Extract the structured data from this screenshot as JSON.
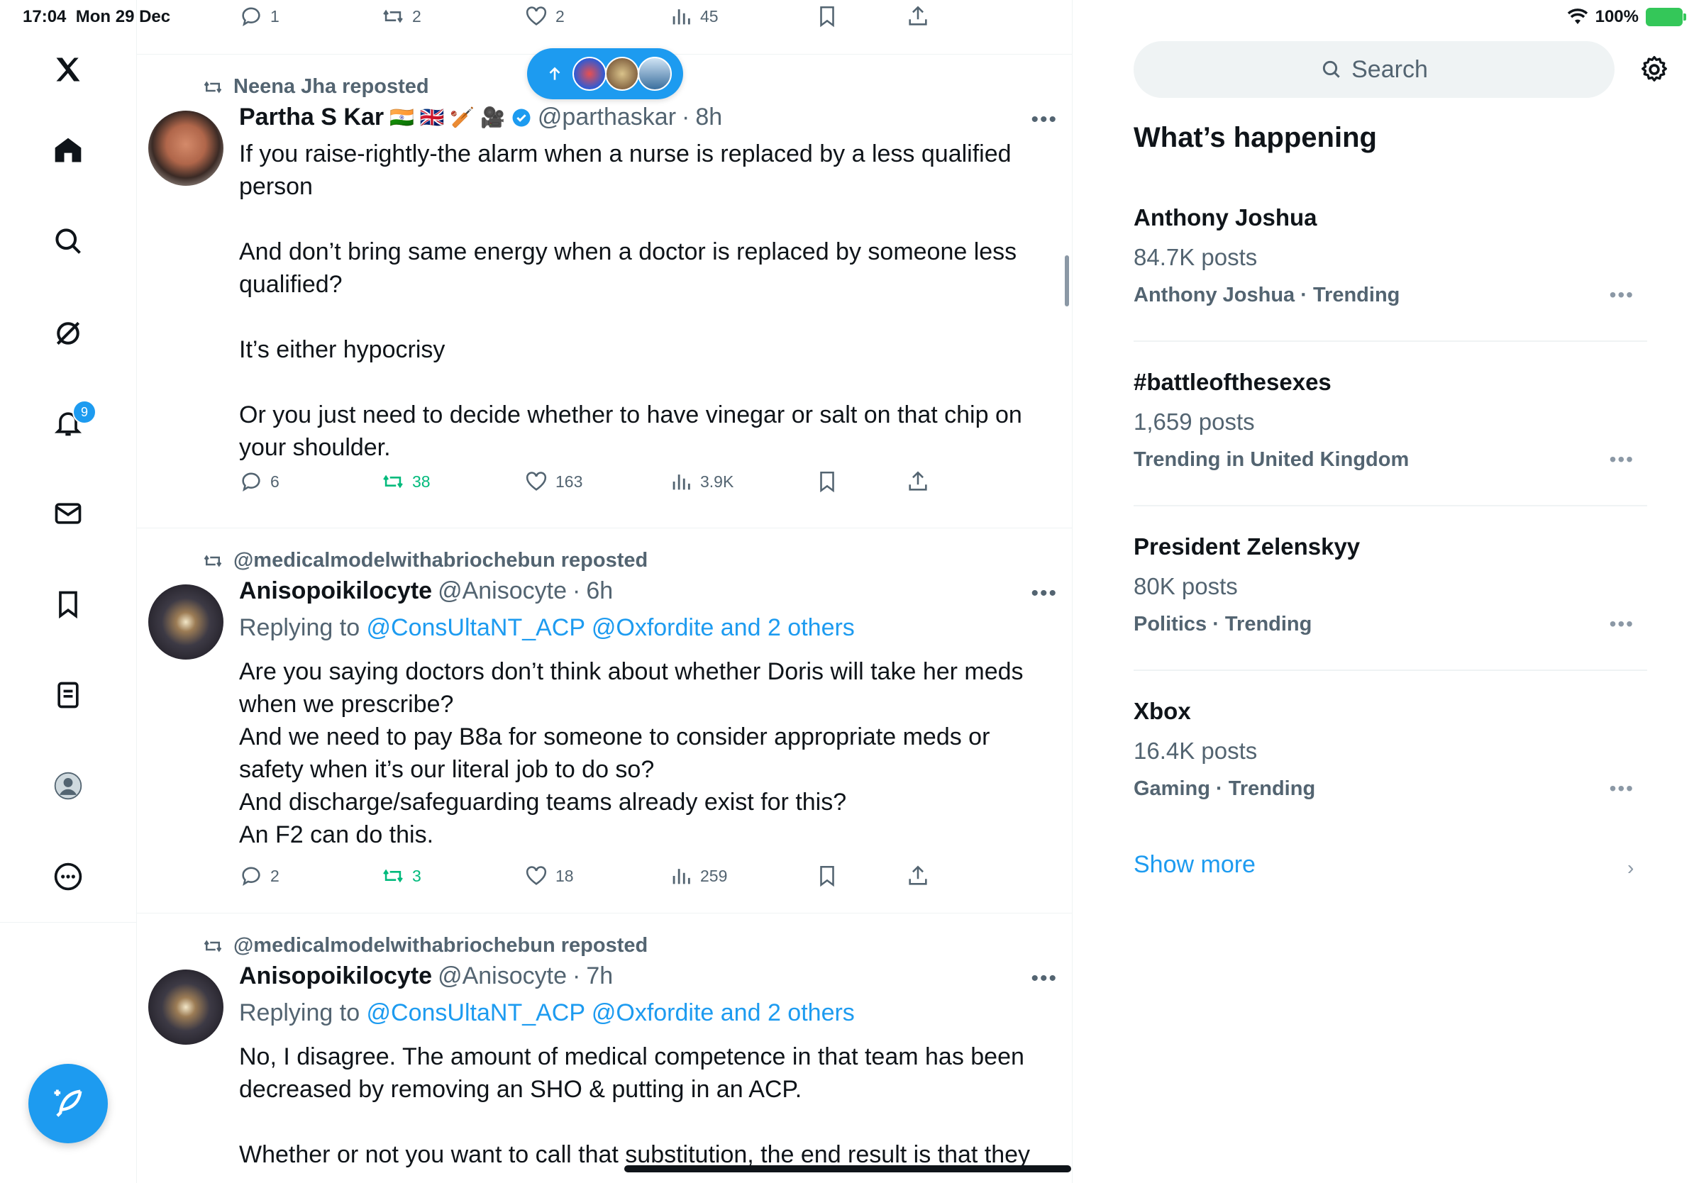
{
  "status_bar": {
    "time": "17:04",
    "date": "Mon 29 Dec",
    "battery": "100%"
  },
  "nav": {
    "notifications_badge": "9"
  },
  "top_actions": {
    "replies": "1",
    "reposts": "2",
    "likes": "2",
    "views": "45"
  },
  "new_posts_pill": {
    "label": "new posts"
  },
  "tweets": [
    {
      "reposted_by": "Neena Jha reposted",
      "name": "Partha S Kar",
      "flags": "🇮🇳 🇬🇧 🏏 🎥",
      "handle": "@parthaskar",
      "time": "8h",
      "replying": "",
      "text": "If you raise-rightly-the alarm when a nurse is replaced by a less qualified person\n\nAnd don’t bring same energy when a doctor is replaced by someone less qualified?\n\nIt’s either hypocrisy\n\nOr you just need to decide whether to have vinegar or salt on that chip on your shoulder.",
      "replies": "6",
      "reposts": "38",
      "likes": "163",
      "views": "3.9K"
    },
    {
      "reposted_by": "@medicalmodelwithabriochebun reposted",
      "name": "Anisopoikilocyte",
      "handle": "@Anisocyte",
      "time": "6h",
      "replying_prefix": "Replying to ",
      "replying_links": "@ConsUltaNT_ACP @Oxfordite and 2 others",
      "text": "Are you saying doctors don’t think about whether Doris will take her meds when we prescribe?\nAnd we need to pay B8a for someone to consider appropriate meds or safety when it’s our literal job to do so?\nAnd discharge/safeguarding teams already exist for this?\nAn F2 can do this.",
      "replies": "2",
      "reposts": "3",
      "likes": "18",
      "views": "259"
    },
    {
      "reposted_by": "@medicalmodelwithabriochebun reposted",
      "name": "Anisopoikilocyte",
      "handle": "@Anisocyte",
      "time": "7h",
      "replying_prefix": "Replying to ",
      "replying_links": "@ConsUltaNT_ACP @Oxfordite and 2 others",
      "text": "No, I disagree. The amount of medical competence in that team has been decreased by removing an SHO & putting in an ACP.\n\nWhether or not you want to call that substitution, the end result is that they"
    }
  ],
  "sidebar": {
    "search_placeholder": "Search",
    "whats_happening": "What’s happening",
    "trends": [
      {
        "name": "Anthony Joshua",
        "posts": "84.7K posts",
        "meta": "Anthony Joshua · Trending"
      },
      {
        "name": "#battleofthesexes",
        "posts": "1,659 posts",
        "meta": "Trending in United Kingdom"
      },
      {
        "name": "President Zelenskyy",
        "posts": "80K posts",
        "meta": "Politics · Trending"
      },
      {
        "name": "Xbox",
        "posts": "16.4K posts",
        "meta": "Gaming · Trending"
      }
    ],
    "show_more": "Show more"
  },
  "colors": {
    "accent": "#1d9bf0",
    "repost_green": "#00ba7c",
    "text_secondary": "#536471"
  }
}
